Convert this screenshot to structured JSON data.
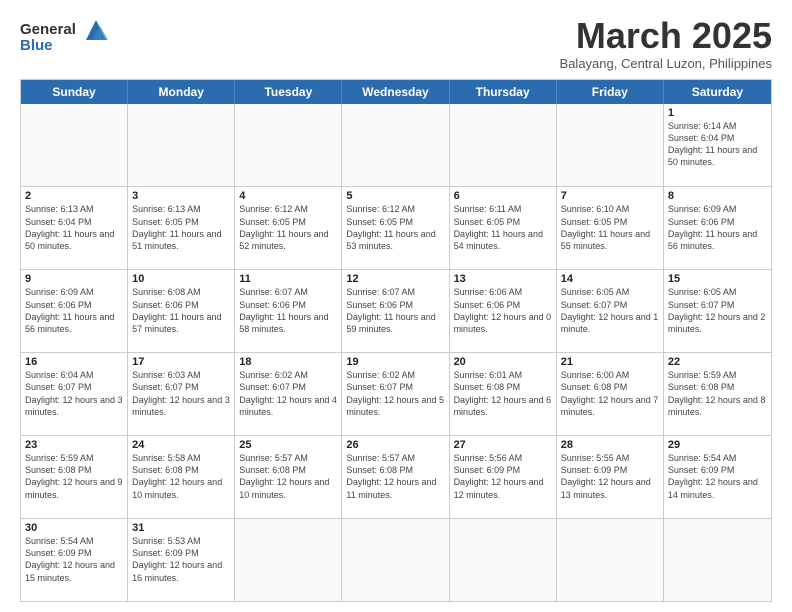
{
  "header": {
    "logo_general": "General",
    "logo_blue": "Blue",
    "month_title": "March 2025",
    "location": "Balayang, Central Luzon, Philippines"
  },
  "weekdays": [
    "Sunday",
    "Monday",
    "Tuesday",
    "Wednesday",
    "Thursday",
    "Friday",
    "Saturday"
  ],
  "weeks": [
    [
      {
        "day": "",
        "info": ""
      },
      {
        "day": "",
        "info": ""
      },
      {
        "day": "",
        "info": ""
      },
      {
        "day": "",
        "info": ""
      },
      {
        "day": "",
        "info": ""
      },
      {
        "day": "",
        "info": ""
      },
      {
        "day": "1",
        "info": "Sunrise: 6:14 AM\nSunset: 6:04 PM\nDaylight: 11 hours and 50 minutes."
      }
    ],
    [
      {
        "day": "2",
        "info": "Sunrise: 6:13 AM\nSunset: 6:04 PM\nDaylight: 11 hours and 50 minutes."
      },
      {
        "day": "3",
        "info": "Sunrise: 6:13 AM\nSunset: 6:05 PM\nDaylight: 11 hours and 51 minutes."
      },
      {
        "day": "4",
        "info": "Sunrise: 6:12 AM\nSunset: 6:05 PM\nDaylight: 11 hours and 52 minutes."
      },
      {
        "day": "5",
        "info": "Sunrise: 6:12 AM\nSunset: 6:05 PM\nDaylight: 11 hours and 53 minutes."
      },
      {
        "day": "6",
        "info": "Sunrise: 6:11 AM\nSunset: 6:05 PM\nDaylight: 11 hours and 54 minutes."
      },
      {
        "day": "7",
        "info": "Sunrise: 6:10 AM\nSunset: 6:05 PM\nDaylight: 11 hours and 55 minutes."
      },
      {
        "day": "8",
        "info": "Sunrise: 6:09 AM\nSunset: 6:06 PM\nDaylight: 11 hours and 56 minutes."
      }
    ],
    [
      {
        "day": "9",
        "info": "Sunrise: 6:09 AM\nSunset: 6:06 PM\nDaylight: 11 hours and 56 minutes."
      },
      {
        "day": "10",
        "info": "Sunrise: 6:08 AM\nSunset: 6:06 PM\nDaylight: 11 hours and 57 minutes."
      },
      {
        "day": "11",
        "info": "Sunrise: 6:07 AM\nSunset: 6:06 PM\nDaylight: 11 hours and 58 minutes."
      },
      {
        "day": "12",
        "info": "Sunrise: 6:07 AM\nSunset: 6:06 PM\nDaylight: 11 hours and 59 minutes."
      },
      {
        "day": "13",
        "info": "Sunrise: 6:06 AM\nSunset: 6:06 PM\nDaylight: 12 hours and 0 minutes."
      },
      {
        "day": "14",
        "info": "Sunrise: 6:05 AM\nSunset: 6:07 PM\nDaylight: 12 hours and 1 minute."
      },
      {
        "day": "15",
        "info": "Sunrise: 6:05 AM\nSunset: 6:07 PM\nDaylight: 12 hours and 2 minutes."
      }
    ],
    [
      {
        "day": "16",
        "info": "Sunrise: 6:04 AM\nSunset: 6:07 PM\nDaylight: 12 hours and 3 minutes."
      },
      {
        "day": "17",
        "info": "Sunrise: 6:03 AM\nSunset: 6:07 PM\nDaylight: 12 hours and 3 minutes."
      },
      {
        "day": "18",
        "info": "Sunrise: 6:02 AM\nSunset: 6:07 PM\nDaylight: 12 hours and 4 minutes."
      },
      {
        "day": "19",
        "info": "Sunrise: 6:02 AM\nSunset: 6:07 PM\nDaylight: 12 hours and 5 minutes."
      },
      {
        "day": "20",
        "info": "Sunrise: 6:01 AM\nSunset: 6:08 PM\nDaylight: 12 hours and 6 minutes."
      },
      {
        "day": "21",
        "info": "Sunrise: 6:00 AM\nSunset: 6:08 PM\nDaylight: 12 hours and 7 minutes."
      },
      {
        "day": "22",
        "info": "Sunrise: 5:59 AM\nSunset: 6:08 PM\nDaylight: 12 hours and 8 minutes."
      }
    ],
    [
      {
        "day": "23",
        "info": "Sunrise: 5:59 AM\nSunset: 6:08 PM\nDaylight: 12 hours and 9 minutes."
      },
      {
        "day": "24",
        "info": "Sunrise: 5:58 AM\nSunset: 6:08 PM\nDaylight: 12 hours and 10 minutes."
      },
      {
        "day": "25",
        "info": "Sunrise: 5:57 AM\nSunset: 6:08 PM\nDaylight: 12 hours and 10 minutes."
      },
      {
        "day": "26",
        "info": "Sunrise: 5:57 AM\nSunset: 6:08 PM\nDaylight: 12 hours and 11 minutes."
      },
      {
        "day": "27",
        "info": "Sunrise: 5:56 AM\nSunset: 6:09 PM\nDaylight: 12 hours and 12 minutes."
      },
      {
        "day": "28",
        "info": "Sunrise: 5:55 AM\nSunset: 6:09 PM\nDaylight: 12 hours and 13 minutes."
      },
      {
        "day": "29",
        "info": "Sunrise: 5:54 AM\nSunset: 6:09 PM\nDaylight: 12 hours and 14 minutes."
      }
    ],
    [
      {
        "day": "30",
        "info": "Sunrise: 5:54 AM\nSunset: 6:09 PM\nDaylight: 12 hours and 15 minutes."
      },
      {
        "day": "31",
        "info": "Sunrise: 5:53 AM\nSunset: 6:09 PM\nDaylight: 12 hours and 16 minutes."
      },
      {
        "day": "",
        "info": ""
      },
      {
        "day": "",
        "info": ""
      },
      {
        "day": "",
        "info": ""
      },
      {
        "day": "",
        "info": ""
      },
      {
        "day": "",
        "info": ""
      }
    ]
  ]
}
